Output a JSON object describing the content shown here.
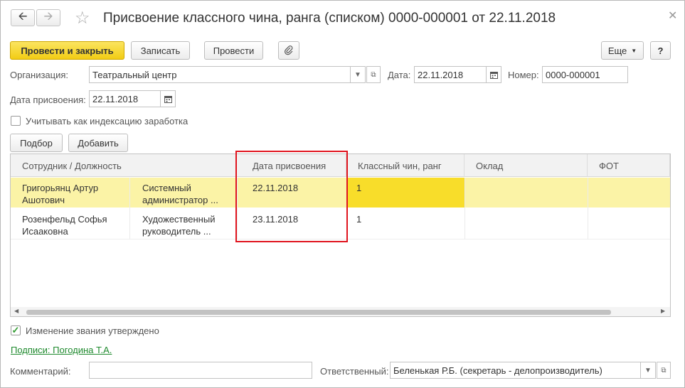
{
  "window": {
    "title": "Присвоение классного чина, ранга (списком) 0000-000001 от 22.11.2018"
  },
  "toolbar": {
    "post_close_label": "Провести и закрыть",
    "save_label": "Записать",
    "post_label": "Провести",
    "more_label": "Еще",
    "help_label": "?"
  },
  "form": {
    "organization_label": "Организация:",
    "organization_value": "Театральный центр",
    "date_label": "Дата:",
    "date_value": "22.11.2018",
    "number_label": "Номер:",
    "number_value": "0000-000001",
    "assign_date_label": "Дата присвоения:",
    "assign_date_value": "22.11.2018",
    "indexation_label": "Учитывать как индексацию заработка",
    "select_label": "Подбор",
    "add_label": "Добавить"
  },
  "table": {
    "headers": [
      "Сотрудник / Должность",
      "Дата присвоения",
      "Классный чин, ранг",
      "Оклад",
      "ФОТ"
    ],
    "rows": [
      {
        "employee": [
          "Григорьянц Артур",
          "Ашотович"
        ],
        "position": [
          "Системный",
          "администратор ..."
        ],
        "date": "22.11.2018",
        "rank": "1"
      },
      {
        "employee": [
          "Розенфельд Софья",
          "Исааковна"
        ],
        "position": [
          "Художественный",
          "руководитель ..."
        ],
        "date": "23.11.2018",
        "rank": "1"
      }
    ]
  },
  "footer": {
    "approved_label": "Изменение звания утверждено",
    "signatures_link": "Подписи: Погодина Т.А.",
    "comment_label": "Комментарий:",
    "comment_value": "",
    "responsible_label": "Ответственный:",
    "responsible_value": "Беленькая Р.Б. (секретарь - делопроизводитель)"
  },
  "colors": {
    "primary_button": "#f2cc14",
    "selected_row": "#fbf3a6",
    "selected_cell": "#f8dd2a",
    "highlight_frame": "#e0141e",
    "link": "#1f8a2e"
  },
  "icons": {
    "back": "arrow-left-icon",
    "forward": "arrow-right-icon",
    "favorite": "star-icon",
    "close": "close-icon",
    "attach": "paperclip-icon",
    "calendar": "calendar-icon",
    "dropdown": "chevron-down-icon",
    "open": "open-form-icon",
    "check": "checkmark-icon"
  }
}
